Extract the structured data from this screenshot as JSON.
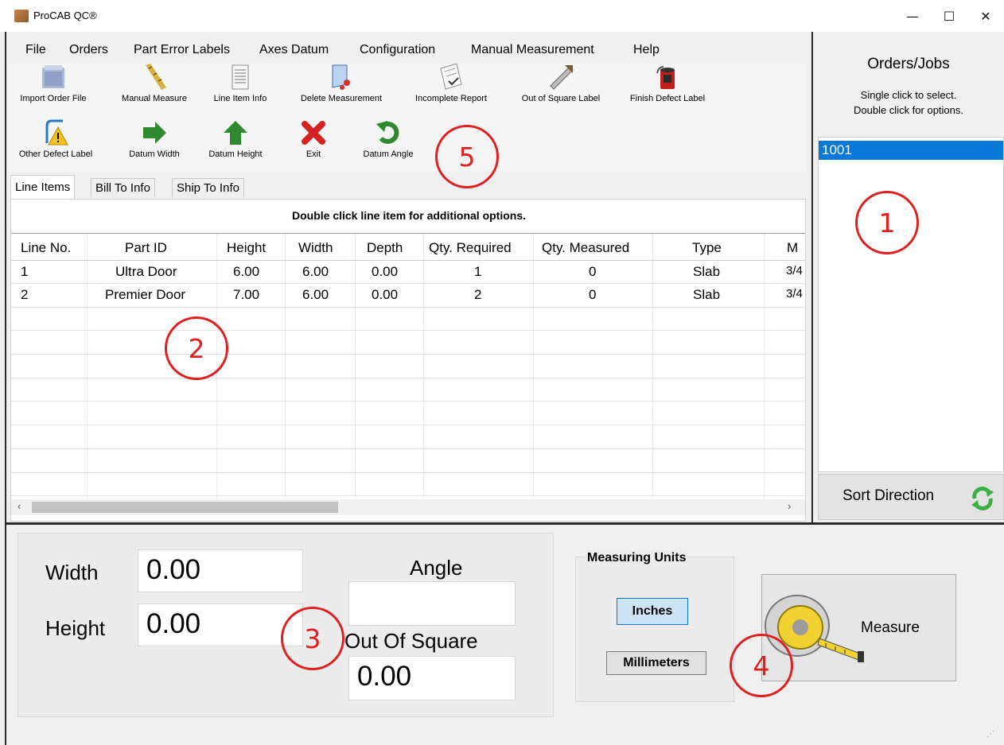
{
  "window": {
    "title": "ProCAB QC®",
    "controls": {
      "minimize": "—",
      "maximize": "☐",
      "close": "✕"
    }
  },
  "menu": [
    "File",
    "Orders",
    "Part Error Labels",
    "Axes Datum",
    "Configuration",
    "Manual Measurement",
    "Help"
  ],
  "toolbar": {
    "row1": [
      {
        "label": "Import Order File",
        "icon": "folder-icon"
      },
      {
        "label": "Manual Measure",
        "icon": "ruler-icon"
      },
      {
        "label": "Line Item Info",
        "icon": "document-icon"
      },
      {
        "label": "Delete Measurement",
        "icon": "delete-measure-icon"
      },
      {
        "label": "Incomplete Report",
        "icon": "report-icon"
      },
      {
        "label": "Out of Square Label",
        "icon": "square-icon"
      },
      {
        "label": "Finish Defect Label",
        "icon": "paint-can-icon"
      }
    ],
    "row2": [
      {
        "label": "Other Defect Label",
        "icon": "warning-icon"
      },
      {
        "label": "Datum Width",
        "icon": "arrow-right-icon"
      },
      {
        "label": "Datum Height",
        "icon": "arrow-up-icon"
      },
      {
        "label": "Exit",
        "icon": "exit-x-icon"
      },
      {
        "label": "Datum Angle",
        "icon": "rotate-icon"
      }
    ]
  },
  "tabs": [
    "Line Items",
    "Bill To Info",
    "Ship To Info"
  ],
  "grid": {
    "hint": "Double click line item for additional options.",
    "columns": [
      "Line No.",
      "Part ID",
      "Height",
      "Width",
      "Depth",
      "Qty. Required",
      "Qty. Measured",
      "Type",
      "M"
    ],
    "rows": [
      [
        "1",
        "Ultra Door",
        "6.00",
        "6.00",
        "0.00",
        "1",
        "0",
        "Slab",
        "3/4"
      ],
      [
        "2",
        "Premier Door",
        "7.00",
        "6.00",
        "0.00",
        "2",
        "0",
        "Slab",
        "3/4"
      ]
    ]
  },
  "orders": {
    "title": "Orders/Jobs",
    "hint_line1": "Single click to select.",
    "hint_line2": "Double click for options.",
    "items": [
      "1001"
    ],
    "sort_label": "Sort Direction"
  },
  "measure": {
    "width_label": "Width",
    "width_value": "0.00",
    "height_label": "Height",
    "height_value": "0.00",
    "angle_label": "Angle",
    "angle_value": "",
    "oos_label": "Out Of Square",
    "oos_value": "0.00",
    "units_title": "Measuring Units",
    "unit_inches": "Inches",
    "unit_mm": "Millimeters",
    "measure_button": "Measure"
  },
  "annotations": [
    "1",
    "2",
    "3",
    "4",
    "5"
  ],
  "colors": {
    "selection": "#0a78d7",
    "annotation": "#e02020"
  }
}
